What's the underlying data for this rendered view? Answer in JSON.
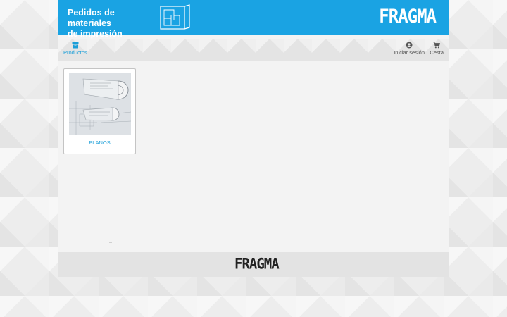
{
  "header": {
    "title": "Pedidos de materiales\nde impresión",
    "logo_text": "FRAGMA",
    "plan_icon": "blueprint-icon",
    "color": "#1aa3e3"
  },
  "navbar": {
    "products": {
      "label": "Productos",
      "icon": "box-icon"
    },
    "login": {
      "label": "Iniciar sesión",
      "icon": "user-icon"
    },
    "cart": {
      "label": "Cesta",
      "icon": "cart-icon"
    }
  },
  "products": [
    {
      "label": "PLANOS",
      "image": "blueprint-rolls-image"
    }
  ],
  "footer": {
    "logo_text": "FRAGMA"
  }
}
